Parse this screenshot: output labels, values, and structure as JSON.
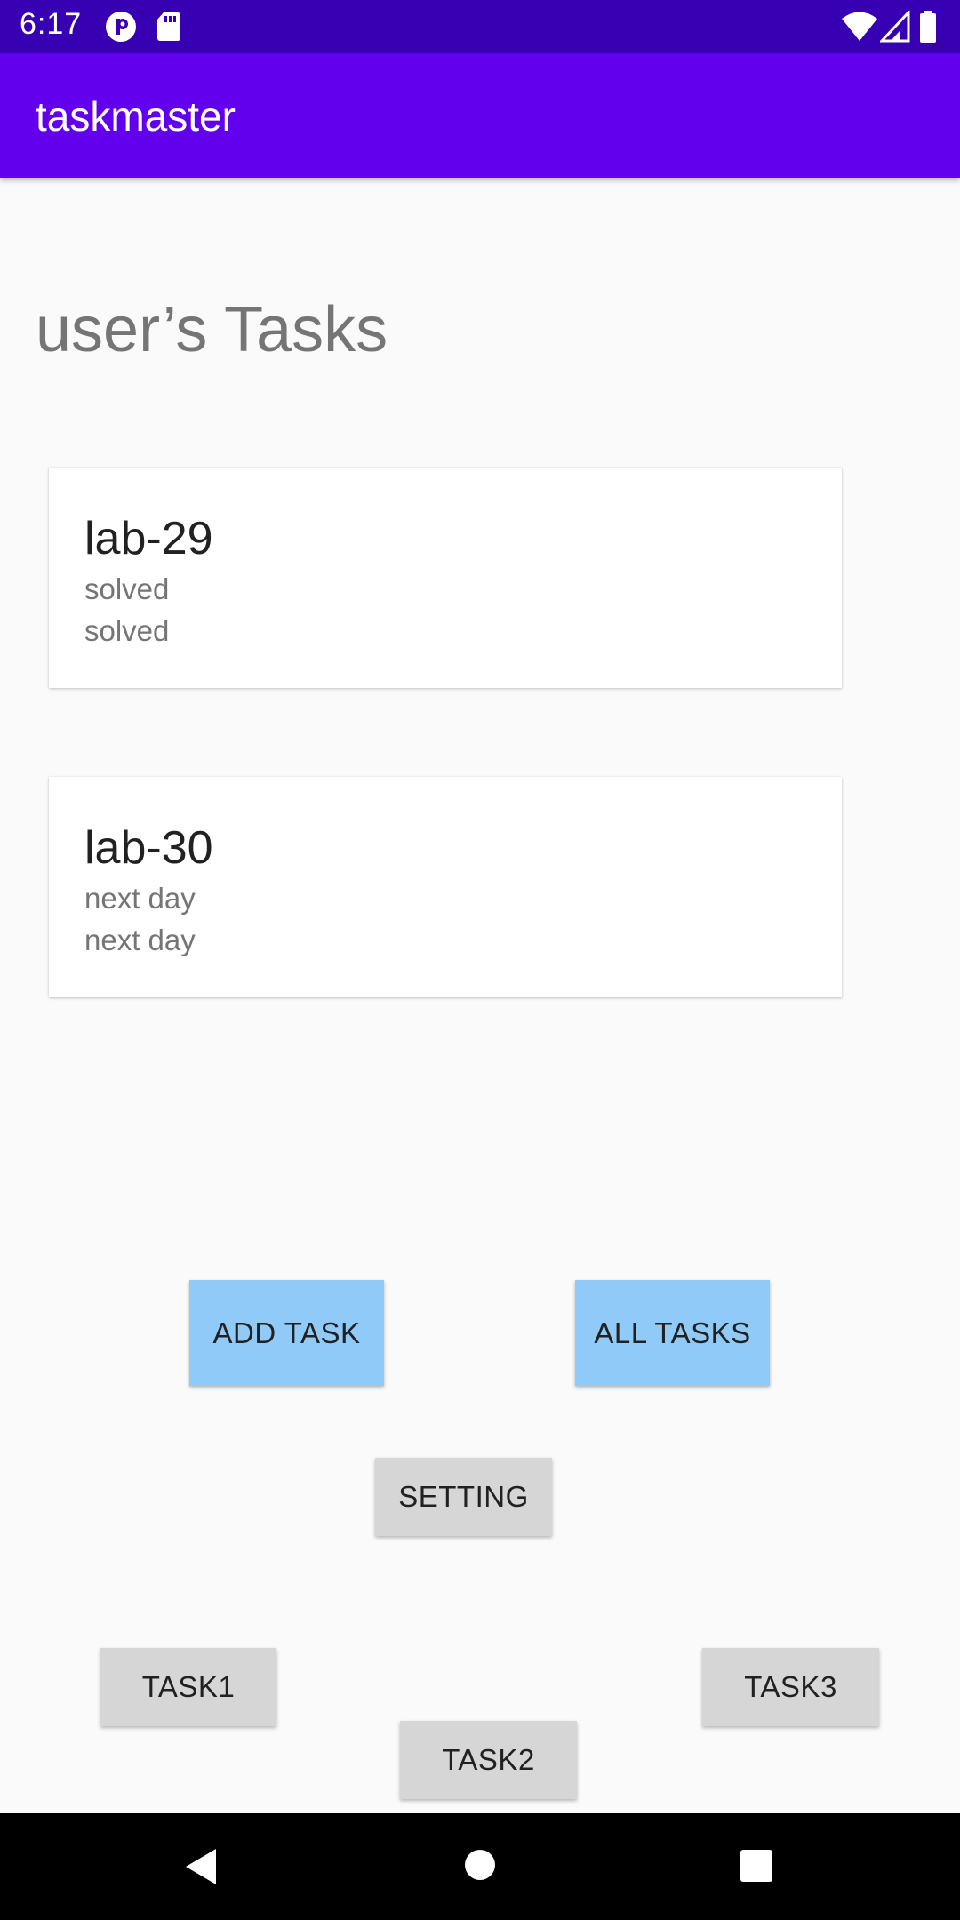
{
  "status_bar": {
    "time": "6:17",
    "icons_left": [
      "p-circle-icon",
      "sd-card-icon"
    ],
    "icons_right": [
      "wifi-icon",
      "signal-icon",
      "battery-icon"
    ]
  },
  "app_bar": {
    "title": "taskmaster"
  },
  "main": {
    "heading": "user’s Tasks",
    "tasks": [
      {
        "title": "lab-29",
        "line1": "solved",
        "line2": "solved"
      },
      {
        "title": "lab-30",
        "line1": "next day",
        "line2": "next day"
      }
    ]
  },
  "buttons": {
    "add_task": "ADD TASK",
    "all_tasks": "ALL TASKS",
    "setting": "SETTING",
    "task1": "TASK1",
    "task2": "TASK2",
    "task3": "TASK3"
  },
  "nav_bar": {
    "icons": [
      "back-icon",
      "home-icon",
      "recents-icon"
    ]
  },
  "colors": {
    "status_bar": "#3700b3",
    "app_bar": "#6200ee",
    "primary_button": "#90caf9",
    "secondary_button": "#d6d6d6"
  }
}
